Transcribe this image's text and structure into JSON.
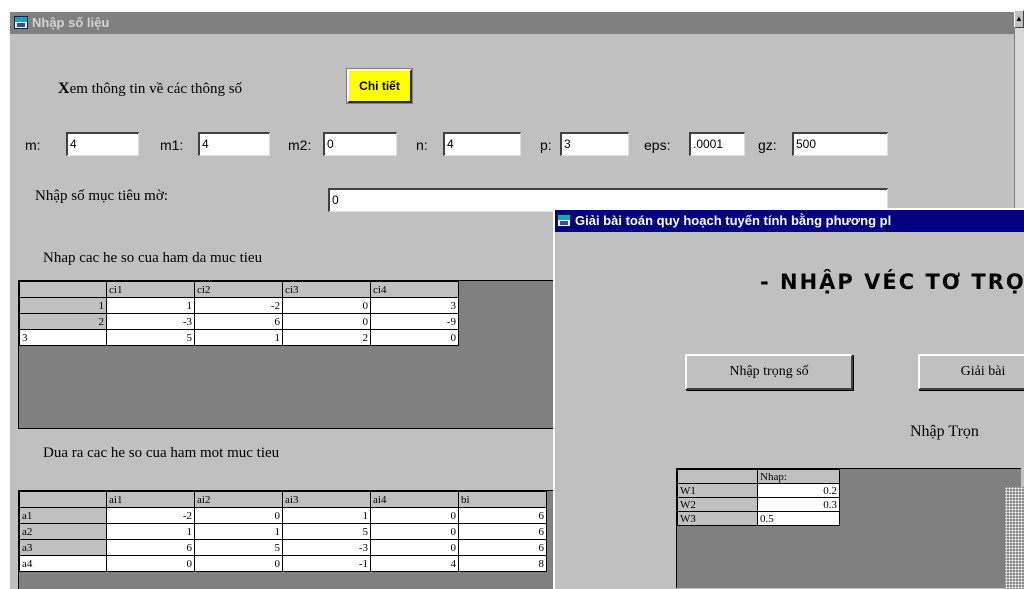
{
  "main_window": {
    "title": "Nhập số liệu",
    "info_label_bold": "X",
    "info_label_rest": "em thông tin về các thông số",
    "details_button": "Chi tiết",
    "params": [
      {
        "label": "m:",
        "value": "4"
      },
      {
        "label": "m1:",
        "value": "4"
      },
      {
        "label": "m2:",
        "value": "0"
      },
      {
        "label": "n:",
        "value": "4"
      },
      {
        "label": "p:",
        "value": "3"
      },
      {
        "label": "eps:",
        "value": ".0001"
      },
      {
        "label": "gz:",
        "value": "500"
      }
    ],
    "fuzzy_label": "Nhập số mục tiêu mờ:",
    "fuzzy_value": "0",
    "multi_obj_label": "Nhap cac he so cua ham da muc tieu",
    "multi_obj_grid": {
      "columns": [
        "",
        "ci1",
        "ci2",
        "ci3",
        "ci4"
      ],
      "rows": [
        [
          "1",
          "1",
          "-2",
          "0",
          "3"
        ],
        [
          "2",
          "-3",
          "6",
          "0",
          "-9"
        ],
        [
          "3",
          "5",
          "1",
          "2",
          "0"
        ]
      ]
    },
    "single_obj_label": "Dua ra cac he so cua ham mot muc tieu",
    "single_obj_grid": {
      "columns": [
        "",
        "ai1",
        "ai2",
        "ai3",
        "ai4",
        "bi"
      ],
      "rows": [
        [
          "a1",
          "-2",
          "0",
          "1",
          "0",
          "6"
        ],
        [
          "a2",
          "1",
          "1",
          "5",
          "0",
          "6"
        ],
        [
          "a3",
          "6",
          "5",
          "-3",
          "0",
          "6"
        ],
        [
          "a4",
          "0",
          "0",
          "-1",
          "4",
          "8"
        ]
      ]
    }
  },
  "dialog": {
    "title": "Giải bài toán quy hoạch tuyến tính bằng phương pl",
    "heading": "- NHẬP VÉC TƠ TRỌ",
    "btn_enter_weights": "Nhập trọng số",
    "btn_solve": "Giải bài",
    "weights_label": "Nhập Trọn",
    "weights_grid": {
      "columns": [
        "",
        "Nhap:"
      ],
      "rows": [
        [
          "W1",
          "0.2"
        ],
        [
          "W2",
          "0.3"
        ],
        [
          "W3",
          "0.5"
        ]
      ]
    }
  },
  "colors": {
    "form_bg": "#c0c0c0",
    "inactive_title": "#808080",
    "active_title": "#000080",
    "button_accent": "#ffff00"
  },
  "icons": [
    "window-icon",
    "scroll-up-arrow-icon"
  ]
}
